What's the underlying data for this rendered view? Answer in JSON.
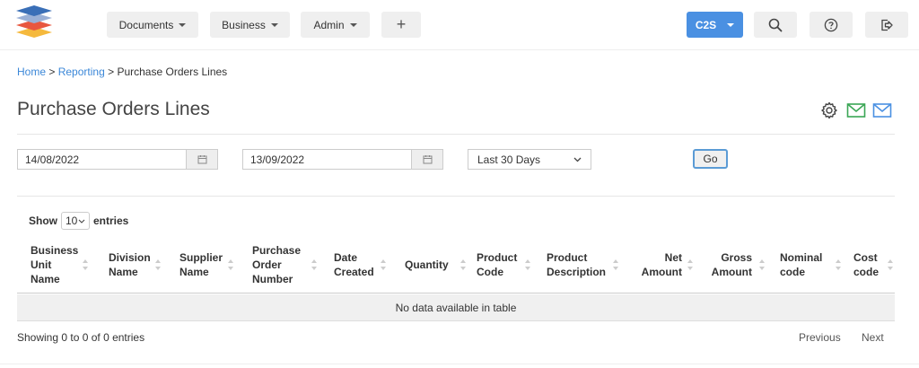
{
  "nav": {
    "documents": "Documents",
    "business": "Business",
    "admin": "Admin",
    "add": "+",
    "account": "C2S"
  },
  "icons": {
    "logo": "stacked-layers-logo",
    "search": "search-icon",
    "help": "help-icon",
    "logout": "logout-icon",
    "settings": "gear-icon",
    "email_green": "email-icon",
    "email_blue": "email-icon",
    "calendar": "calendar-icon"
  },
  "colors": {
    "accent": "#4a90e2",
    "link": "#3b87d8",
    "email_green": "#3aa655",
    "email_blue": "#4a90e2"
  },
  "breadcrumb": {
    "home": "Home",
    "sep1": ">",
    "reporting": "Reporting",
    "sep2": ">",
    "current": "Purchase Orders Lines"
  },
  "page": {
    "title": "Purchase Orders Lines"
  },
  "filters": {
    "from_date": "14/08/2022",
    "to_date": "13/09/2022",
    "range": "Last 30 Days",
    "go": "Go"
  },
  "table": {
    "show_label": "Show",
    "length": "10",
    "entries_label": "entries",
    "columns": [
      {
        "l1": "Business",
        "l2": "Unit",
        "l3": "Name"
      },
      {
        "l1": "Division",
        "l2": "Name",
        "l3": ""
      },
      {
        "l1": "Supplier",
        "l2": "Name",
        "l3": ""
      },
      {
        "l1": "Purchase",
        "l2": "Order",
        "l3": "Number"
      },
      {
        "l1": "Date",
        "l2": "Created",
        "l3": ""
      },
      {
        "l1": "Quantity",
        "l2": "",
        "l3": ""
      },
      {
        "l1": "Product",
        "l2": "Code",
        "l3": ""
      },
      {
        "l1": "Product",
        "l2": "Description",
        "l3": ""
      },
      {
        "l1": "Net",
        "l2": "Amount",
        "l3": ""
      },
      {
        "l1": "Gross",
        "l2": "Amount",
        "l3": ""
      },
      {
        "l1": "Nominal",
        "l2": "code",
        "l3": ""
      },
      {
        "l1": "Cost",
        "l2": "code",
        "l3": ""
      }
    ],
    "empty": "No data available in table",
    "info": "Showing 0 to 0 of 0 entries",
    "previous": "Previous",
    "next": "Next"
  }
}
